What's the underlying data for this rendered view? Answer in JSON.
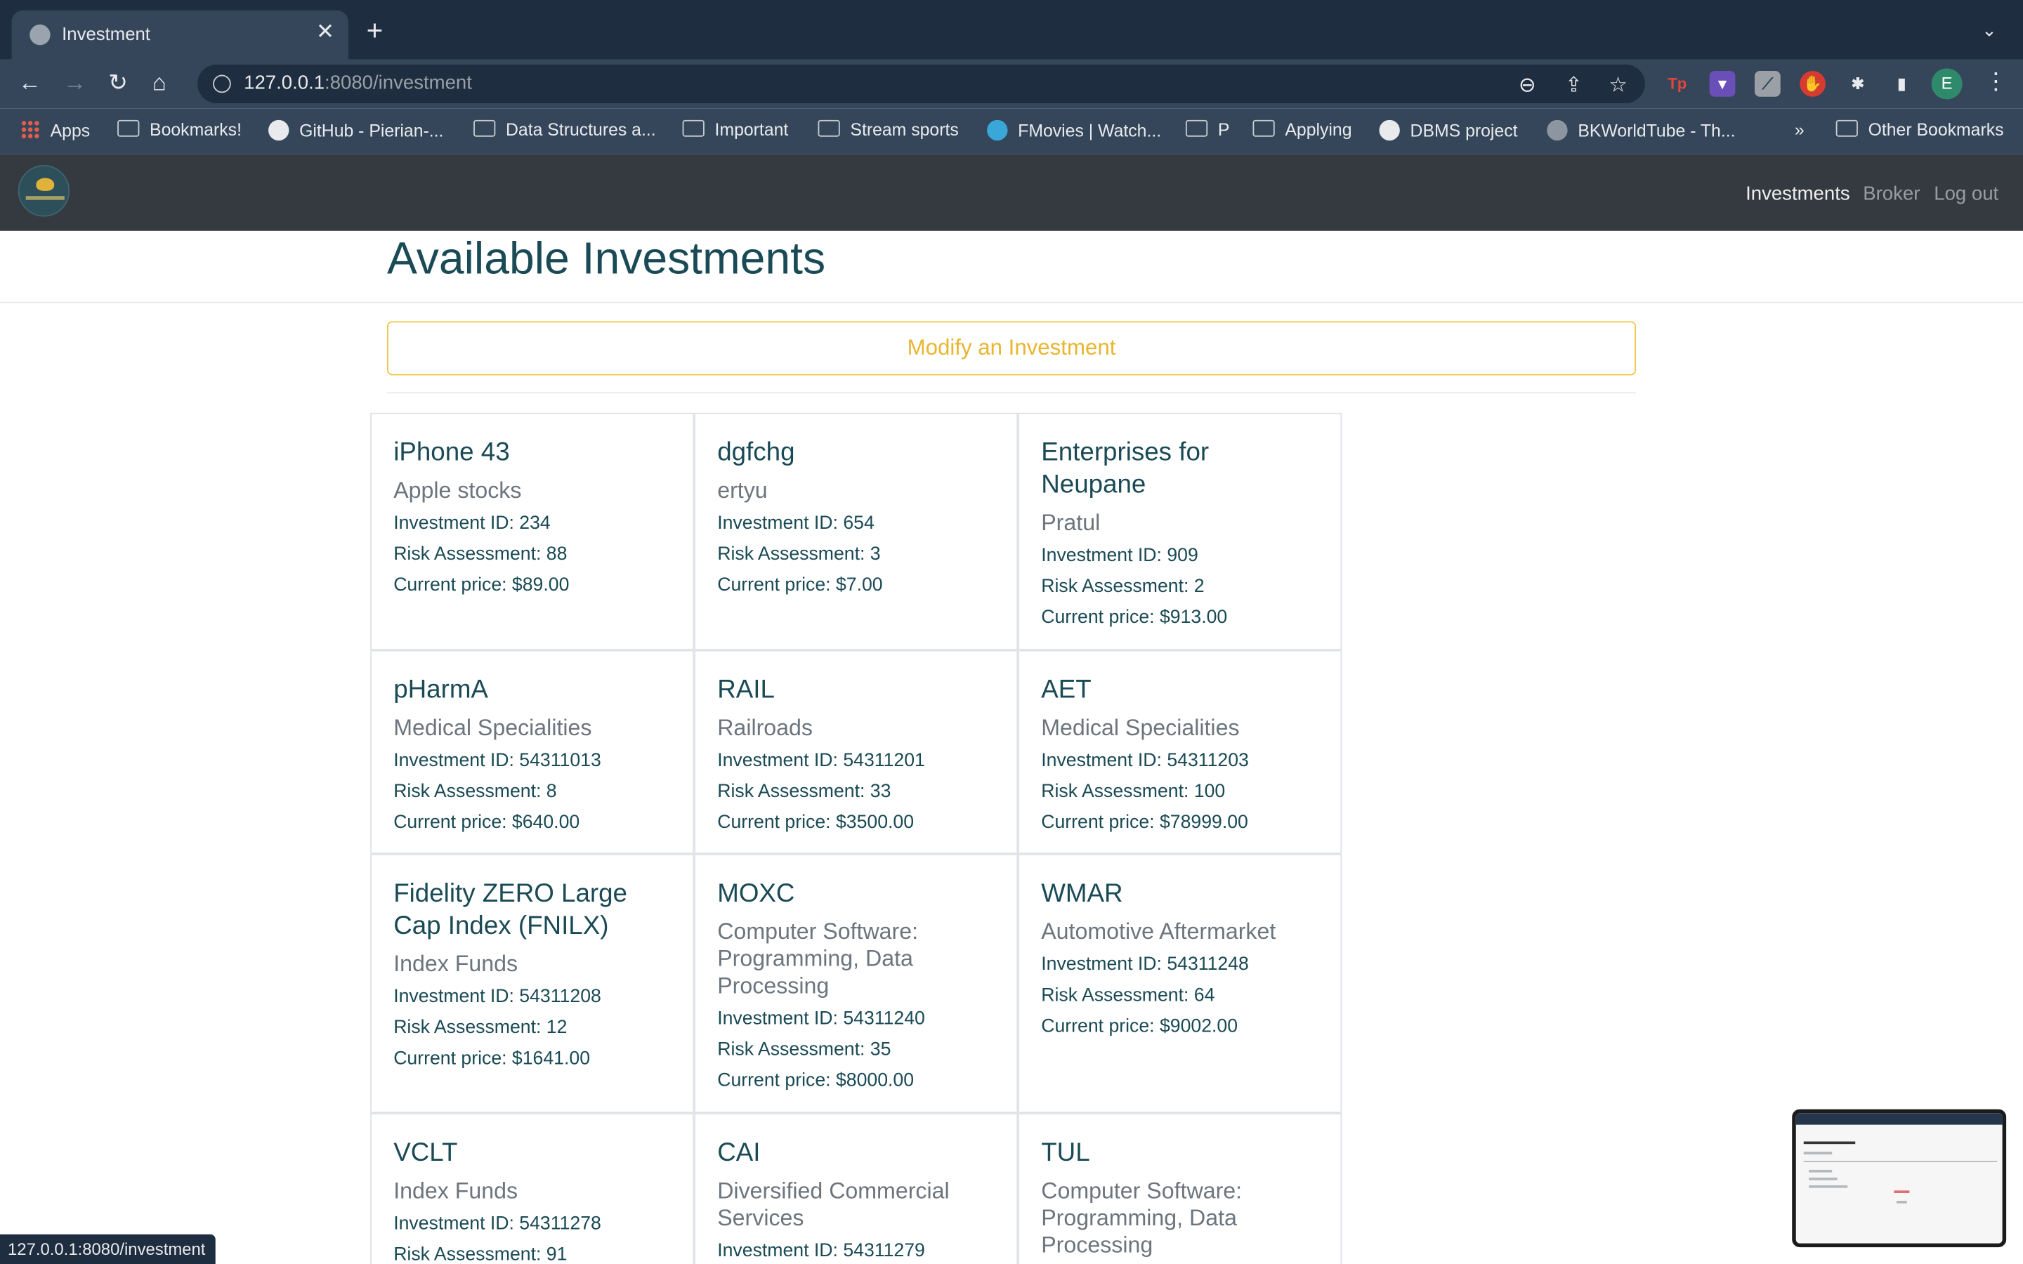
{
  "browser": {
    "tab_title": "Investment",
    "url_host": "127.0.0.1",
    "url_path": ":8080/investment",
    "bookmarks": [
      {
        "label": "Apps",
        "icon": "apps-grid-icon"
      },
      {
        "label": "Bookmarks!",
        "icon": "folder-icon"
      },
      {
        "label": "GitHub - Pierian-...",
        "icon": "github-icon"
      },
      {
        "label": "Data Structures a...",
        "icon": "folder-icon"
      },
      {
        "label": "Important",
        "icon": "folder-icon"
      },
      {
        "label": "Stream sports",
        "icon": "folder-icon"
      },
      {
        "label": "FMovies | Watch...",
        "icon": "play-icon"
      },
      {
        "label": "P",
        "icon": "folder-icon"
      },
      {
        "label": "Applying",
        "icon": "folder-icon"
      },
      {
        "label": "DBMS project",
        "icon": "github-icon"
      },
      {
        "label": "BKWorldTube - Th...",
        "icon": "globe-icon"
      },
      {
        "label": "»",
        "icon": ""
      },
      {
        "label": "Other Bookmarks",
        "icon": "folder-icon"
      }
    ],
    "avatar_initial": "E",
    "status_url": "127.0.0.1:8080/investment"
  },
  "nav": {
    "links": [
      "Investments",
      "Broker",
      "Log out"
    ]
  },
  "page": {
    "title": "Available Investments",
    "modify_label": "Modify an Investment"
  },
  "investments": [
    {
      "name": "iPhone 43",
      "category": "Apple stocks",
      "id_line": "Investment ID: 234",
      "risk_line": "Risk Assessment: 88",
      "price_line": "Current price: $89.00"
    },
    {
      "name": "dgfchg",
      "category": "ertyu",
      "id_line": "Investment ID: 654",
      "risk_line": "Risk Assessment: 3",
      "price_line": "Current price: $7.00"
    },
    {
      "name": "Enterprises for Neupane",
      "category": "Pratul",
      "id_line": "Investment ID: 909",
      "risk_line": "Risk Assessment: 2",
      "price_line": "Current price: $913.00"
    },
    {
      "name": "pHarmA",
      "category": "Medical Specialities",
      "id_line": "Investment ID: 54311013",
      "risk_line": "Risk Assessment: 8",
      "price_line": "Current price: $640.00"
    },
    {
      "name": "RAIL",
      "category": "Railroads",
      "id_line": "Investment ID: 54311201",
      "risk_line": "Risk Assessment: 33",
      "price_line": "Current price: $3500.00"
    },
    {
      "name": "AET",
      "category": "Medical Specialities",
      "id_line": "Investment ID: 54311203",
      "risk_line": "Risk Assessment: 100",
      "price_line": "Current price: $78999.00"
    },
    {
      "name": "Fidelity ZERO Large Cap Index (FNILX)",
      "category": "Index Funds",
      "id_line": "Investment ID: 54311208",
      "risk_line": "Risk Assessment: 12",
      "price_line": "Current price: $1641.00"
    },
    {
      "name": "MOXC",
      "category": "Computer Software: Programming, Data Processing",
      "id_line": "Investment ID: 54311240",
      "risk_line": "Risk Assessment: 35",
      "price_line": "Current price: $8000.00"
    },
    {
      "name": "WMAR",
      "category": "Automotive Aftermarket",
      "id_line": "Investment ID: 54311248",
      "risk_line": "Risk Assessment: 64",
      "price_line": "Current price: $9002.00"
    },
    {
      "name": "VCLT",
      "category": "Index Funds",
      "id_line": "Investment ID: 54311278",
      "risk_line": "Risk Assessment: 91",
      "price_line": ""
    },
    {
      "name": "CAI",
      "category": "Diversified Commercial Services",
      "id_line": "Investment ID: 54311279",
      "risk_line": "",
      "price_line": ""
    },
    {
      "name": "TUL",
      "category": "Computer Software: Programming, Data Processing",
      "id_line": "",
      "risk_line": "",
      "price_line": ""
    }
  ]
}
